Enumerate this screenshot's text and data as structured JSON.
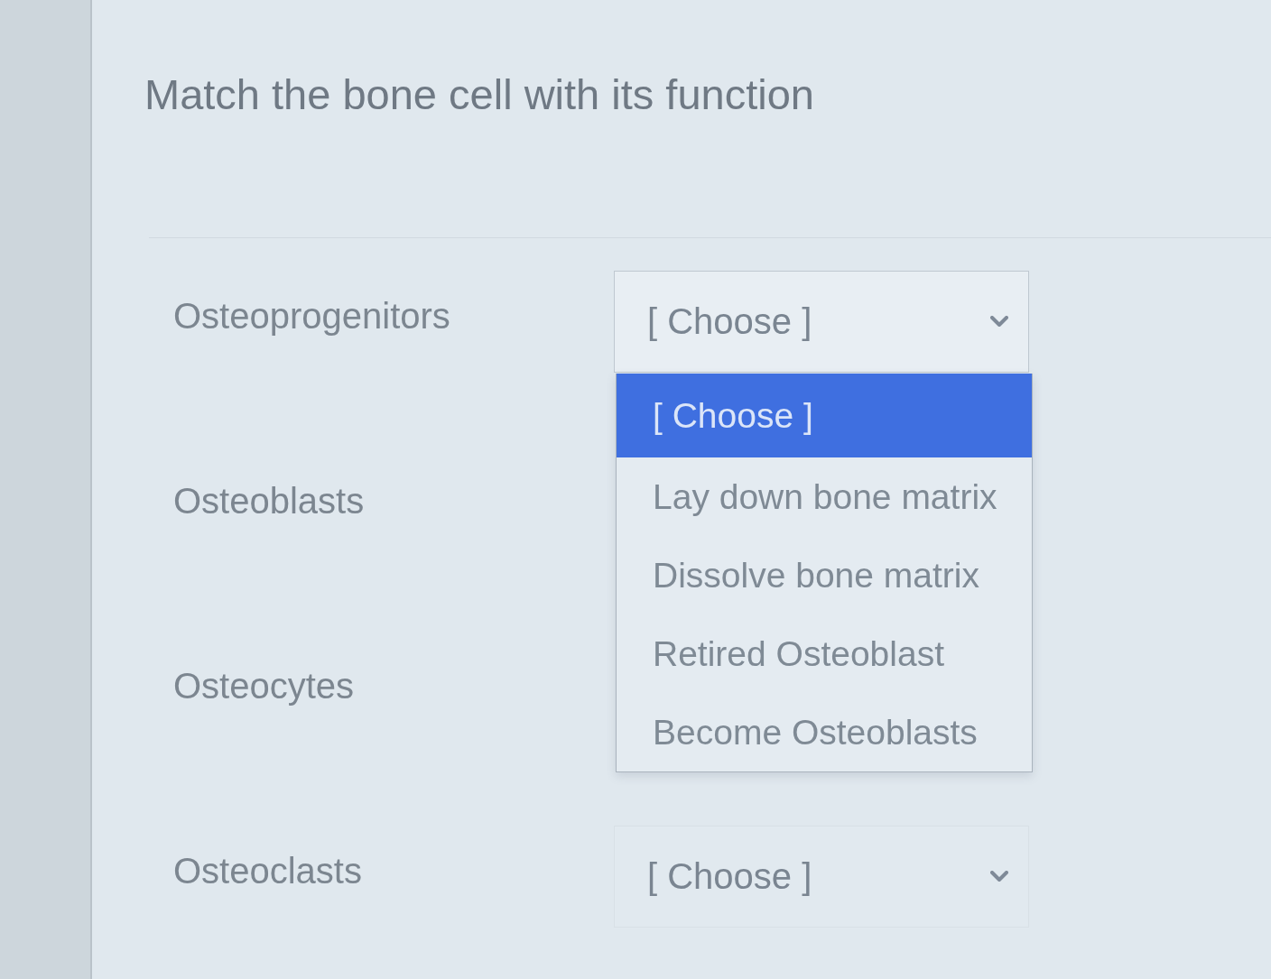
{
  "question": {
    "title": "Match the bone cell with its function"
  },
  "rows": [
    {
      "term": "Osteoprogenitors",
      "select": {
        "value": "[ Choose ]",
        "expanded": true,
        "options": [
          {
            "label": "[ Choose ]",
            "selected": true
          },
          {
            "label": "Lay down bone matrix",
            "selected": false
          },
          {
            "label": "Dissolve bone matrix",
            "selected": false
          },
          {
            "label": "Retired Osteoblast",
            "selected": false
          },
          {
            "label": "Become Osteoblasts",
            "selected": false
          }
        ]
      }
    },
    {
      "term": "Osteoblasts"
    },
    {
      "term": "Osteocytes"
    },
    {
      "term": "Osteoclasts",
      "select": {
        "value": "[ Choose ]",
        "expanded": false
      }
    }
  ]
}
